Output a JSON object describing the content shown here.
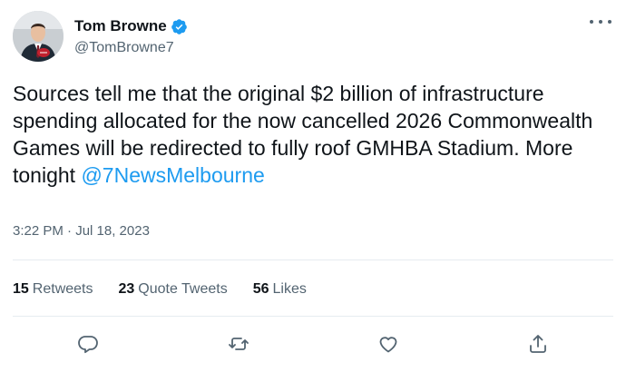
{
  "author": {
    "display_name": "Tom Browne",
    "handle": "@TomBrowne7",
    "verified": true,
    "avatar_icon": "profile-photo"
  },
  "tweet": {
    "text_before": "Sources tell me that the original $2 billion of infrastructure spending allocated for the now cancelled 2026 Commonwealth Games will be redirected to fully roof GMHBA Stadium. More tonight ",
    "mention": "@7NewsMelbourne",
    "timestamp": "3:22 PM · Jul 18, 2023"
  },
  "stats": {
    "retweets_count": "15",
    "retweets_label": "Retweets",
    "quotes_count": "23",
    "quotes_label": "Quote Tweets",
    "likes_count": "56",
    "likes_label": "Likes"
  },
  "actions": {
    "reply_icon": "reply-icon",
    "retweet_icon": "retweet-icon",
    "like_icon": "heart-icon",
    "share_icon": "share-icon"
  },
  "colors": {
    "link": "#1d9bf0",
    "text": "#0f1419",
    "secondary": "#536471",
    "divider": "#e6ecf0"
  }
}
